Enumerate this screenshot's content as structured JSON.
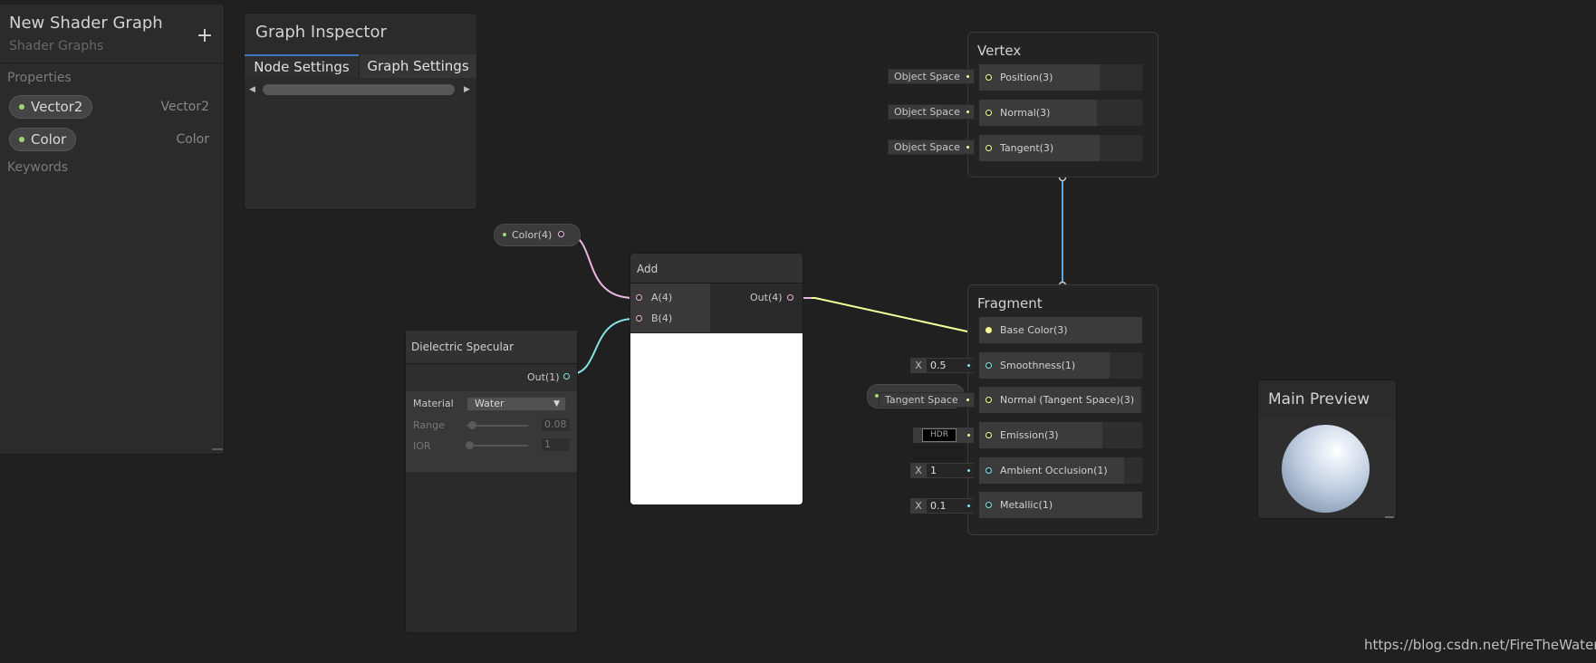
{
  "blackboard": {
    "title": "New Shader Graph",
    "subtitle": "Shader Graphs",
    "add_label": "+",
    "properties_label": "Properties",
    "keywords_label": "Keywords",
    "properties": [
      {
        "name": "Vector2",
        "type": "Vector2",
        "dot_color": "#9ed870"
      },
      {
        "name": "Color",
        "type": "Color",
        "dot_color": "#9ed870"
      }
    ]
  },
  "inspector": {
    "title": "Graph Inspector",
    "tabs": [
      {
        "label": "Node Settings",
        "active": true
      },
      {
        "label": "Graph Settings",
        "active": false
      }
    ],
    "accent": "#3a79bb"
  },
  "nodes": {
    "color_property": {
      "label": "Color(4)"
    },
    "add": {
      "title": "Add",
      "inputs": [
        "A(4)",
        "B(4)"
      ],
      "output": "Out(4)"
    },
    "dielectric": {
      "title": "Dielectric Specular",
      "output": "Out(1)",
      "material_label": "Material",
      "material_value": "Water",
      "range_label": "Range",
      "range_value": "0.08",
      "ior_label": "IOR",
      "ior_value": "1"
    }
  },
  "vertex": {
    "title": "Vertex",
    "blocks": [
      {
        "label": "Position(3)",
        "chip": "Object Space"
      },
      {
        "label": "Normal(3)",
        "chip": "Object Space"
      },
      {
        "label": "Tangent(3)",
        "chip": "Object Space"
      }
    ]
  },
  "fragment": {
    "title": "Fragment",
    "blocks": [
      {
        "label": "Base Color(3)"
      },
      {
        "label": "Smoothness(1)",
        "field_prefix": "X",
        "field_value": "0.5"
      },
      {
        "label": "Normal (Tangent Space)(3)",
        "chip": "Tangent Space"
      },
      {
        "label": "Emission(3)",
        "chip": "HDR"
      },
      {
        "label": "Ambient Occlusion(1)",
        "field_prefix": "X",
        "field_value": "1"
      },
      {
        "label": "Metallic(1)",
        "field_prefix": "X",
        "field_value": "0.1"
      }
    ]
  },
  "preview": {
    "title": "Main Preview"
  },
  "watermark": "https://blog.csdn.net/FireTheWater",
  "colors": {
    "vector4": "#e8b6e0",
    "vector3": "#f6ff9a",
    "vector1": "#84e4e7",
    "flow": "#5aa9e6"
  }
}
